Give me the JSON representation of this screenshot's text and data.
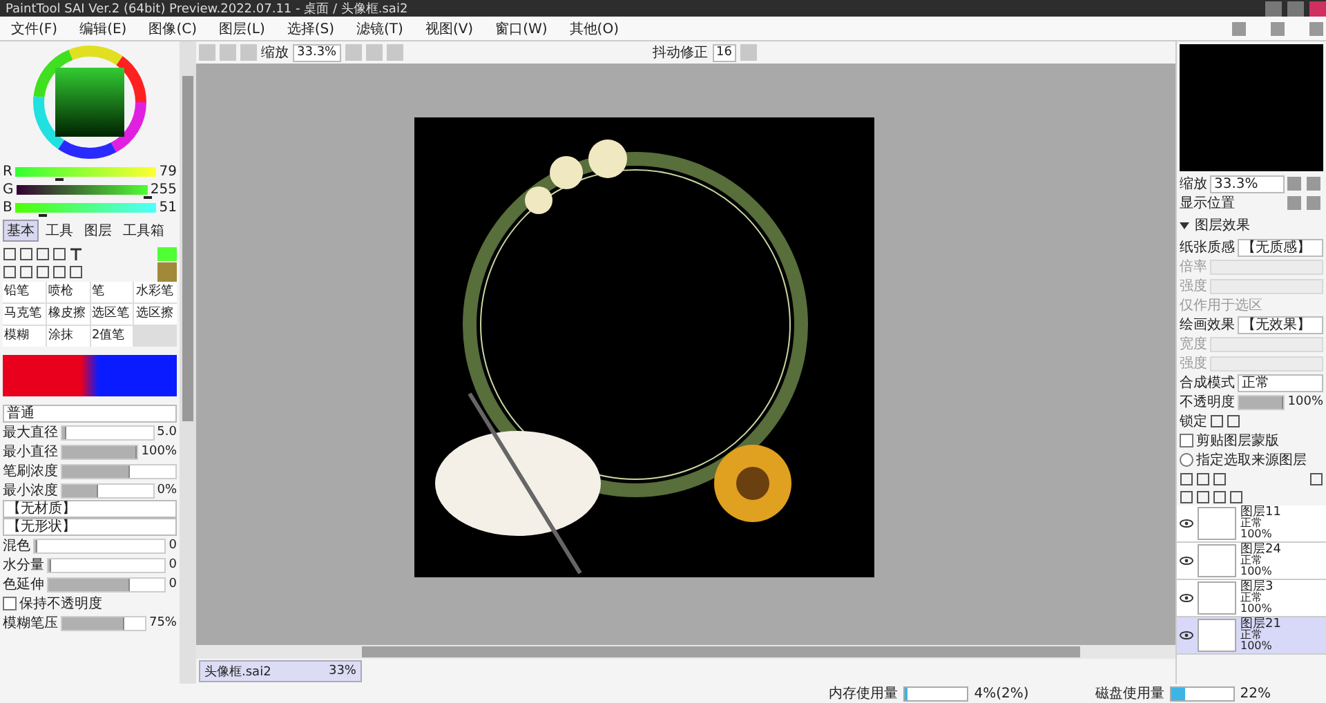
{
  "window": {
    "title": "PaintTool SAI Ver.2 (64bit) Preview.2022.07.11 - 桌面 / 头像框.sai2"
  },
  "menu": [
    "文件(F)",
    "编辑(E)",
    "图像(C)",
    "图层(L)",
    "选择(S)",
    "滤镜(T)",
    "视图(V)",
    "窗口(W)",
    "其他(O)"
  ],
  "toolbar": {
    "zoom_label": "缩放",
    "zoom": "33.3%",
    "stabilizer_label": "抖动修正",
    "stabilizer": "16"
  },
  "color": {
    "channels": [
      {
        "name": "R",
        "value": "79",
        "level": 0.31
      },
      {
        "name": "G",
        "value": "255",
        "level": 1
      },
      {
        "name": "B",
        "value": "51",
        "level": 0.2
      }
    ]
  },
  "panel_tabs": [
    {
      "label": "基本",
      "selected": true
    },
    {
      "label": "工具",
      "selected": false
    },
    {
      "label": "图层",
      "selected": false
    },
    {
      "label": "工具箱",
      "selected": false
    }
  ],
  "brushes": [
    {
      "label": "铅笔",
      "selected": false
    },
    {
      "label": "喷枪",
      "selected": false
    },
    {
      "label": "笔",
      "selected": false
    },
    {
      "label": "水彩笔",
      "selected": false
    },
    {
      "label": "马克笔",
      "selected": false
    },
    {
      "label": "橡皮擦",
      "selected": false
    },
    {
      "label": "选区笔",
      "selected": false
    },
    {
      "label": "选区擦",
      "selected": false
    },
    {
      "label": "模糊",
      "selected": false
    },
    {
      "label": "涂抹",
      "selected": false
    },
    {
      "label": "2值笔",
      "selected": false
    }
  ],
  "brush_settings": {
    "mode": "普通",
    "sliders": [
      {
        "label": "最大直径",
        "value": "5.0",
        "level": 0.05
      },
      {
        "label": "最小直径",
        "value": "100%",
        "level": 1
      },
      {
        "label": "笔刷浓度",
        "level": 0.6
      },
      {
        "label": "最小浓度",
        "value": "0%",
        "level": 0.4
      }
    ],
    "texture": "【无材质】",
    "shape": "【无形状】",
    "mix": [
      {
        "label": "混色",
        "value": "0",
        "level": 0
      },
      {
        "label": "水分量",
        "value": "0",
        "level": 0
      },
      {
        "label": "色延伸",
        "value": "0",
        "level": 0.7
      }
    ],
    "keep_opacity": {
      "label": "保持不透明度",
      "checked": false
    },
    "pressure": {
      "label": "模糊笔压",
      "value": "75%",
      "level": 0.75
    }
  },
  "navigator": {
    "zoom_label": "缩放",
    "zoom": "33.3%",
    "angle_label": "显示位置"
  },
  "layer_effects": {
    "title": "图层效果",
    "paper_label": "纸张质感",
    "paper": "【无质感】",
    "paper_rows": [
      {
        "label": "倍率",
        "disabled": true
      },
      {
        "label": "强度",
        "disabled": true
      }
    ],
    "paper_check": "仅作用于选区",
    "effect_label": "绘画效果",
    "effect": "【无效果】",
    "effect_rows": [
      {
        "label": "宽度",
        "disabled": true
      },
      {
        "label": "强度",
        "disabled": true
      }
    ]
  },
  "layer_props": {
    "blend_label": "合成模式",
    "blend": "正常",
    "opacity_label": "不透明度",
    "opacity": "100%",
    "opacity_meter": {
      "level": 1
    },
    "lock_label": "锁定",
    "clip_label": "剪贴图层蒙版",
    "clip_checked": false,
    "source_label": "指定选取来源图层",
    "source_checked": false
  },
  "layers": [
    {
      "name": "图层11",
      "mode": "正常",
      "opacity": "100%",
      "visible": true,
      "selected": false
    },
    {
      "name": "图层24",
      "mode": "正常",
      "opacity": "100%",
      "visible": true,
      "selected": false
    },
    {
      "name": "图层3",
      "mode": "正常",
      "opacity": "100%",
      "visible": true,
      "selected": false
    },
    {
      "name": "图层21",
      "mode": "正常",
      "opacity": "100%",
      "visible": true,
      "selected": true
    }
  ],
  "file_tab": {
    "name": "头像框.sai2",
    "zoom": "33%"
  },
  "status_bar": {
    "memory_label": "内存使用量",
    "memory": "4%(2%)",
    "memory_meter": {
      "level": 0.04
    },
    "disk_label": "磁盘使用量",
    "disk": "22%",
    "disk_meter": {
      "level": 0.22
    }
  }
}
